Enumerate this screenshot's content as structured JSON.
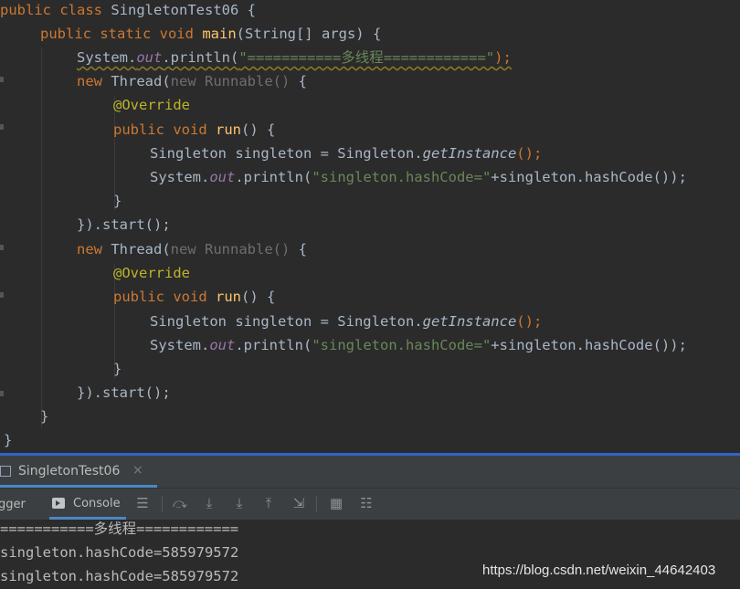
{
  "editor": {
    "line1": {
      "kw1": "public",
      "kw2": "class",
      "name": "SingletonTest06",
      "brace": " {"
    },
    "line2": {
      "kw": "public static void",
      "fn": "main",
      "params": "(String[] args) {"
    },
    "line3": {
      "cls": "System.",
      "field": "out",
      "call": ".println(",
      "str": "\"===========多线程============\"",
      "end": ");"
    },
    "line4": {
      "kw": "new",
      "cls": "Thread(",
      "dim": "new Runnable() ",
      "brace": "{"
    },
    "line5": {
      "annotation": "@Override"
    },
    "line6": {
      "kw": "public void",
      "fn": "run",
      "rest": "() {"
    },
    "line7": {
      "text": "Singleton singleton = Singleton.",
      "method": "getInstance",
      "end": "();"
    },
    "line8": {
      "cls": "System.",
      "field": "out",
      "call": ".println(",
      "str": "\"singleton.hashCode=\"",
      "rest": "+singleton.hashCode());"
    },
    "line9": {
      "brace": "}"
    },
    "line10": {
      "text": "}).start();"
    },
    "line11": {
      "kw": "new",
      "cls": "Thread(",
      "dim": "new Runnable() ",
      "brace": "{"
    },
    "line12": {
      "annotation": "@Override"
    },
    "line13": {
      "kw": "public void",
      "fn": "run",
      "rest": "() {"
    },
    "line14": {
      "text": "Singleton singleton = Singleton.",
      "method": "getInstance",
      "end": "();"
    },
    "line15": {
      "cls": "System.",
      "field": "out",
      "call": ".println(",
      "str": "\"singleton.hashCode=\"",
      "rest": "+singleton.hashCode());"
    },
    "line16": {
      "brace": "}"
    },
    "line17": {
      "text": "}).start();"
    },
    "line18": {
      "brace": "}"
    },
    "line19": {
      "brace": "}"
    }
  },
  "run_panel": {
    "tab_label": "SingletonTest06",
    "tab_close": "×",
    "debugger_tab": "gger",
    "console_tab": "Console"
  },
  "console": {
    "lines": [
      "===========多线程============",
      "singleton.hashCode=585979572",
      "singleton.hashCode=585979572"
    ]
  },
  "watermark": "https://blog.csdn.net/weixin_44642403",
  "colors": {
    "background": "#2b2b2b",
    "keyword": "#cc7832",
    "function": "#ffc66d",
    "string": "#6a8759",
    "annotation": "#bbb529",
    "field": "#9876aa",
    "accent": "#4a88c7"
  }
}
